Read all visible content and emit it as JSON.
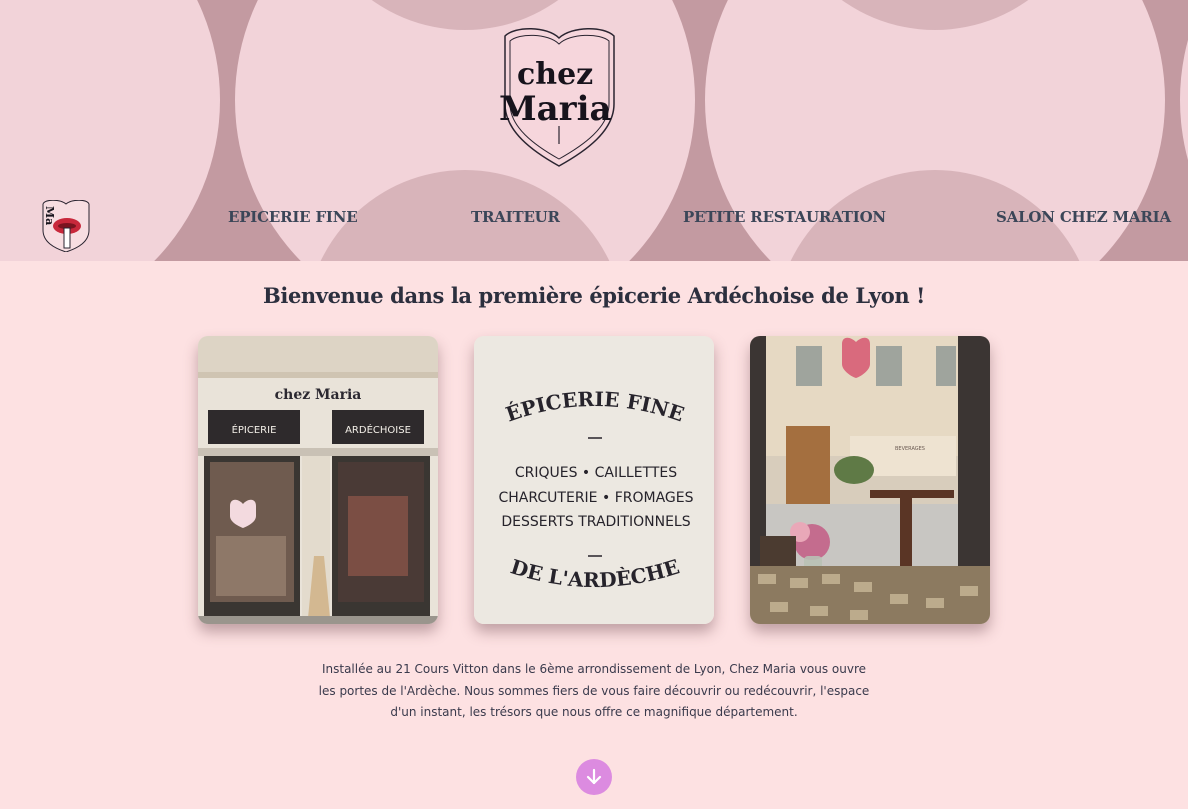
{
  "brand": {
    "logo_line1": "chez",
    "logo_line2": "Maria",
    "small_logo_text": "Ma"
  },
  "nav": {
    "items": [
      {
        "label": "EPICERIE FINE"
      },
      {
        "label": "TRAITEUR"
      },
      {
        "label": "PETITE RESTAURATION"
      },
      {
        "label": "SALON CHEZ MARIA"
      }
    ]
  },
  "main": {
    "title": "Bienvenue dans la première épicerie Ardéchoise de Lyon !",
    "intro": "Installée au 21 Cours Vitton dans le 6ème arrondissement de Lyon, Chez Maria vous ouvre les portes de l'Ardèche. Nous sommes fiers de vous faire découvrir ou redécouvrir, l'espace d'un instant, les trésors que nous offre ce magnifique département."
  },
  "photos": {
    "storefront": {
      "sign_name": "chez Maria",
      "window_left": "ÉPICERIE",
      "window_right": "ARDÉCHOISE"
    },
    "poster": {
      "top": "ÉPICERIE FINE",
      "line1": "CRIQUES • CAILLETTES",
      "line2": "CHARCUTERIE • FROMAGES",
      "line3": "DESSERTS TRADITIONNELS",
      "bottom": "DE L'ARDÈCHE"
    },
    "interior": {
      "small_sign": "BEVERAGES"
    }
  },
  "colors": {
    "header_bg": "#f2d3d9",
    "pattern": "#c39aa1",
    "page_bg": "#fde1e2",
    "nav_text": "#3b4658",
    "scroll_button": "#dc8be0"
  },
  "icons": {
    "scroll": "arrow-down-icon"
  }
}
